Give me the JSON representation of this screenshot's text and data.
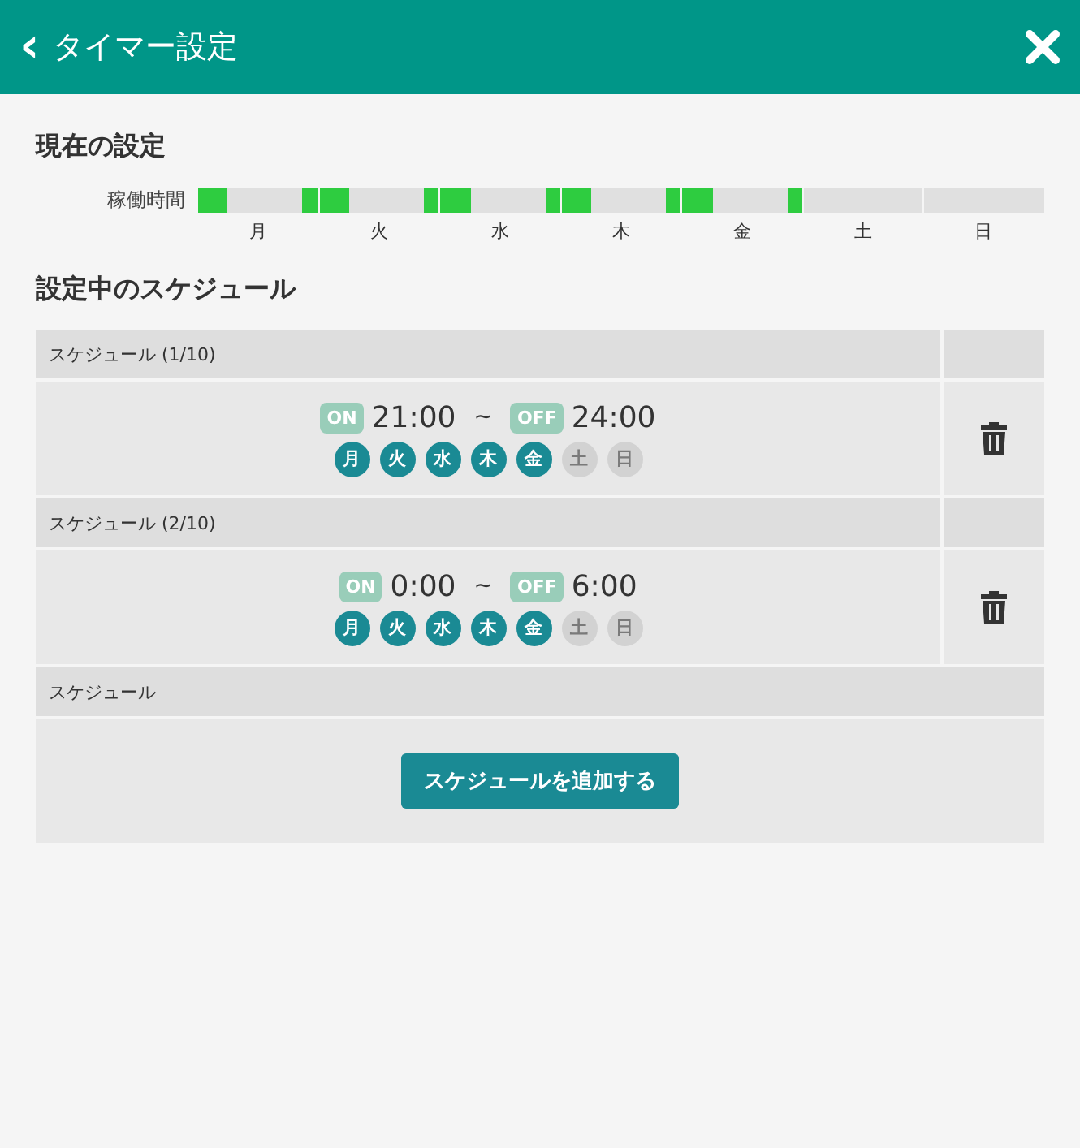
{
  "header": {
    "back_icon": "‹",
    "title": "タイマー設定"
  },
  "current": {
    "heading": "現在の設定",
    "row_label": "稼働時間",
    "days": [
      "月",
      "火",
      "水",
      "木",
      "金",
      "土",
      "日"
    ]
  },
  "schedule_heading": "設定中のスケジュール",
  "schedules": [
    {
      "title": "スケジュール (1/10)",
      "on_badge": "ON",
      "start": "21:00",
      "separator": "~",
      "off_badge": "OFF",
      "end": "24:00",
      "days": [
        {
          "label": "月",
          "selected": true
        },
        {
          "label": "火",
          "selected": true
        },
        {
          "label": "水",
          "selected": true
        },
        {
          "label": "木",
          "selected": true
        },
        {
          "label": "金",
          "selected": true
        },
        {
          "label": "土",
          "selected": false
        },
        {
          "label": "日",
          "selected": false
        }
      ]
    },
    {
      "title": "スケジュール (2/10)",
      "on_badge": "ON",
      "start": "0:00",
      "separator": "~",
      "off_badge": "OFF",
      "end": "6:00",
      "days": [
        {
          "label": "月",
          "selected": true
        },
        {
          "label": "火",
          "selected": true
        },
        {
          "label": "水",
          "selected": true
        },
        {
          "label": "木",
          "selected": true
        },
        {
          "label": "金",
          "selected": true
        },
        {
          "label": "土",
          "selected": false
        },
        {
          "label": "日",
          "selected": false
        }
      ]
    }
  ],
  "add_section": {
    "title": "スケジュール",
    "button": "スケジュールを追加する"
  }
}
